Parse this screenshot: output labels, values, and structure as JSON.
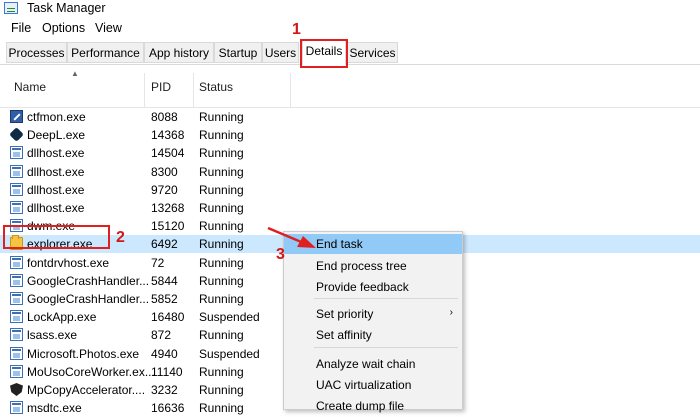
{
  "window": {
    "title": "Task Manager"
  },
  "menu": [
    "File",
    "Options",
    "View"
  ],
  "tabs": [
    "Processes",
    "Performance",
    "App history",
    "Startup",
    "Users",
    "Details",
    "Services"
  ],
  "columns": {
    "name": "Name",
    "pid": "PID",
    "status": "Status"
  },
  "rows": [
    {
      "name": "ctfmon.exe",
      "pid": "8088",
      "status": "Running",
      "icon": "pen-icon"
    },
    {
      "name": "DeepL.exe",
      "pid": "14368",
      "status": "Running",
      "icon": "deepl-icon"
    },
    {
      "name": "dllhost.exe",
      "pid": "14504",
      "status": "Running",
      "icon": "app-icon"
    },
    {
      "name": "dllhost.exe",
      "pid": "8300",
      "status": "Running",
      "icon": "app-icon"
    },
    {
      "name": "dllhost.exe",
      "pid": "9720",
      "status": "Running",
      "icon": "app-icon"
    },
    {
      "name": "dllhost.exe",
      "pid": "13268",
      "status": "Running",
      "icon": "app-icon"
    },
    {
      "name": "dwm.exe",
      "pid": "15120",
      "status": "Running",
      "icon": "app-icon"
    },
    {
      "name": "explorer.exe",
      "pid": "6492",
      "status": "Running",
      "icon": "folder-icon",
      "selected": true
    },
    {
      "name": "fontdrvhost.exe",
      "pid": "72",
      "status": "Running",
      "icon": "app-icon"
    },
    {
      "name": "GoogleCrashHandler...",
      "pid": "5844",
      "status": "Running",
      "icon": "app-icon"
    },
    {
      "name": "GoogleCrashHandler...",
      "pid": "5852",
      "status": "Running",
      "icon": "app-icon"
    },
    {
      "name": "LockApp.exe",
      "pid": "16480",
      "status": "Suspended",
      "icon": "app-icon"
    },
    {
      "name": "lsass.exe",
      "pid": "872",
      "status": "Running",
      "icon": "app-icon"
    },
    {
      "name": "Microsoft.Photos.exe",
      "pid": "4940",
      "status": "Suspended",
      "icon": "app-icon"
    },
    {
      "name": "MoUsoCoreWorker.ex...",
      "pid": "11140",
      "status": "Running",
      "icon": "app-icon"
    },
    {
      "name": "MpCopyAccelerator....",
      "pid": "3232",
      "status": "Running",
      "icon": "shield-icon"
    },
    {
      "name": "msdtc.exe",
      "pid": "16636",
      "status": "Running",
      "icon": "app-icon"
    }
  ],
  "context_menu": [
    {
      "label": "End task",
      "highlighted": true
    },
    {
      "label": "End process tree"
    },
    {
      "label": "Provide feedback"
    },
    {
      "separator": true
    },
    {
      "label": "Set priority",
      "submenu": true
    },
    {
      "label": "Set affinity"
    },
    {
      "separator": true
    },
    {
      "label": "Analyze wait chain"
    },
    {
      "label": "UAC virtualization"
    },
    {
      "label": "Create dump file"
    }
  ],
  "annotations": {
    "step1": "1",
    "step2": "2",
    "step3": "3",
    "color": "#e02020"
  }
}
